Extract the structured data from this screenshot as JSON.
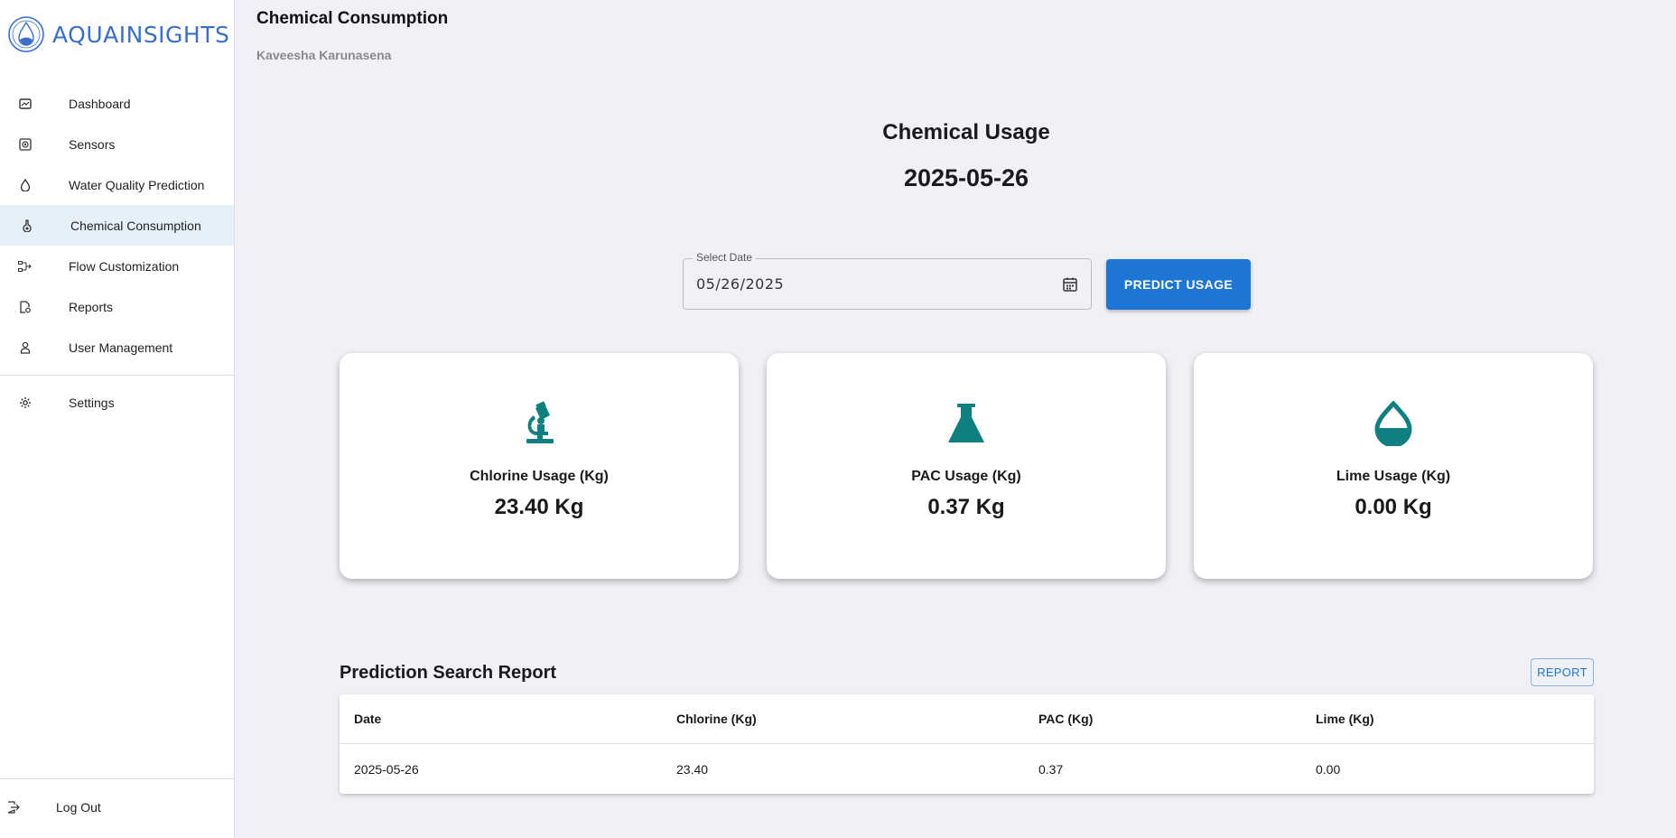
{
  "brand": {
    "name": "AQUAINSIGHTS",
    "color": "#3a6fc9"
  },
  "sidebar": {
    "items": [
      {
        "label": "Dashboard",
        "icon": "dashboard-icon"
      },
      {
        "label": "Sensors",
        "icon": "sensor-icon"
      },
      {
        "label": "Water Quality Prediction",
        "icon": "water-drop-icon"
      },
      {
        "label": "Chemical Consumption",
        "icon": "flask-icon",
        "active": true
      },
      {
        "label": "Flow Customization",
        "icon": "flow-icon"
      },
      {
        "label": "Reports",
        "icon": "report-icon"
      },
      {
        "label": "User Management",
        "icon": "user-icon"
      }
    ],
    "settings": {
      "label": "Settings",
      "icon": "gear-icon"
    },
    "logout": {
      "label": "Log Out",
      "icon": "logout-icon"
    }
  },
  "header": {
    "title": "Chemical Consumption",
    "user": "Kaveesha Karunasena"
  },
  "usage": {
    "title": "Chemical Usage",
    "date": "2025-05-26"
  },
  "date_picker": {
    "label": "Select Date",
    "value": "05/26/2025"
  },
  "predict_button": {
    "label": "PREDICT USAGE",
    "color": "#1e76d4"
  },
  "cards": [
    {
      "label": "Chlorine Usage (Kg)",
      "value": "23.40 Kg",
      "icon": "microscope-icon"
    },
    {
      "label": "PAC Usage (Kg)",
      "value": "0.37 Kg",
      "icon": "flask-icon"
    },
    {
      "label": "Lime Usage (Kg)",
      "value": "0.00 Kg",
      "icon": "drop-icon"
    }
  ],
  "icon_color": "#0e8080",
  "report": {
    "title": "Prediction Search Report",
    "button": "REPORT",
    "columns": [
      "Date",
      "Chlorine (Kg)",
      "PAC (Kg)",
      "Lime (Kg)"
    ],
    "rows": [
      [
        "2025-05-26",
        "23.40",
        "0.37",
        "0.00"
      ]
    ]
  }
}
